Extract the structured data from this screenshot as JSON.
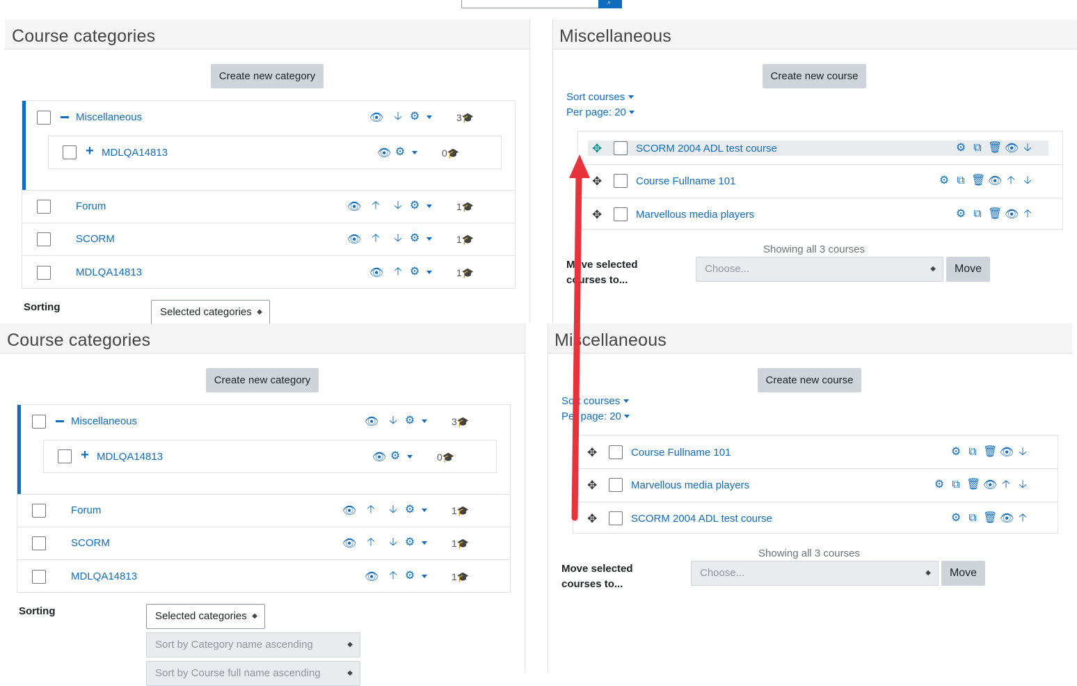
{
  "top_left": {
    "title": "Course categories",
    "create_button": "Create new category",
    "categories": [
      {
        "name": "Miscellaneous",
        "count": "3"
      },
      {
        "name": "MDLQA14813",
        "count": "0"
      },
      {
        "name": "Forum",
        "count": "1"
      },
      {
        "name": "SCORM",
        "count": "1"
      },
      {
        "name": "MDLQA14813",
        "count": "1"
      }
    ],
    "sorting_label": "Sorting",
    "sorting_select": "Selected categories"
  },
  "top_right": {
    "title": "Miscellaneous",
    "create_button": "Create new course",
    "sort_courses": "Sort courses",
    "per_page": "Per page: 20",
    "courses": [
      "SCORM 2004 ADL test course",
      "Course Fullname 101",
      "Marvellous media players"
    ],
    "showing": "Showing all 3 courses",
    "move_label": "Move selected courses to...",
    "move_select_placeholder": "Choose...",
    "move_button": "Move"
  },
  "bottom_left": {
    "title": "Course categories",
    "create_button": "Create new category",
    "categories": [
      {
        "name": "Miscellaneous",
        "count": "3"
      },
      {
        "name": "MDLQA14813",
        "count": "0"
      },
      {
        "name": "Forum",
        "count": "1"
      },
      {
        "name": "SCORM",
        "count": "1"
      },
      {
        "name": "MDLQA14813",
        "count": "1"
      }
    ],
    "sorting_label": "Sorting",
    "sorting_select": "Selected categories",
    "sort_cat_select": "Sort by Category name ascending",
    "sort_course_select": "Sort by Course full name ascending"
  },
  "bottom_right": {
    "title": "Miscellaneous",
    "create_button": "Create new course",
    "sort_courses": "Sort courses",
    "per_page": "Per page: 20",
    "courses": [
      "Course Fullname 101",
      "Marvellous media players",
      "SCORM 2004 ADL test course"
    ],
    "showing": "Showing all 3 courses",
    "move_label": "Move selected courses to...",
    "move_select_placeholder": "Choose...",
    "move_button": "Move"
  },
  "annotation": {
    "color": "#e8323c"
  },
  "icons": {
    "eye": "eye-icon",
    "up": "arrow-up-icon",
    "down": "arrow-down-icon",
    "gear": "gear-icon",
    "course": "graduation-cap-icon",
    "drag": "move-icon",
    "copy": "copy-icon",
    "trash": "trash-icon",
    "search": "search-icon"
  }
}
